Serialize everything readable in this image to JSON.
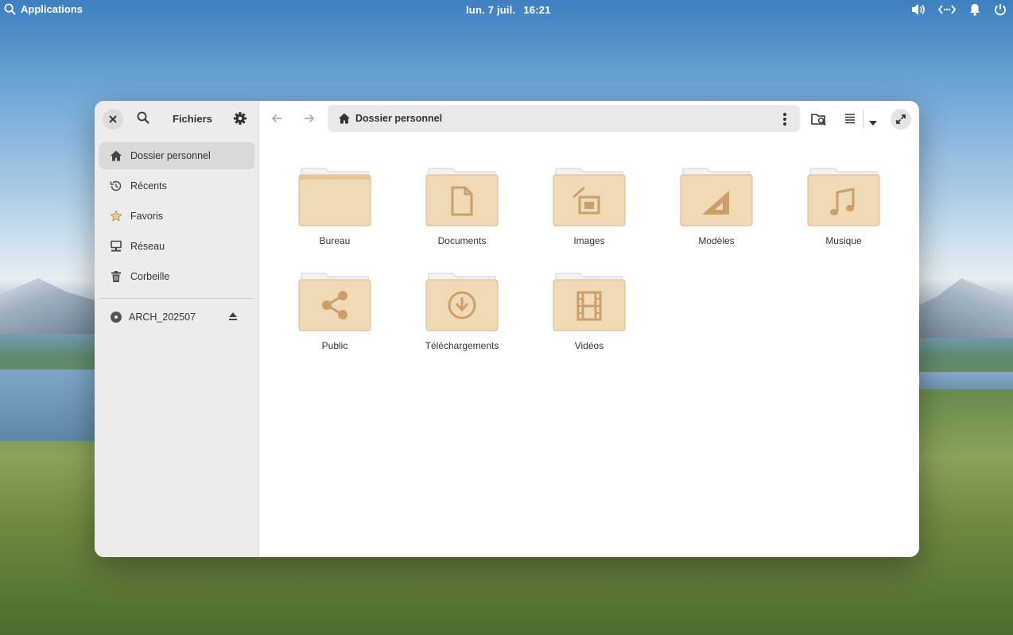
{
  "topbar": {
    "applications_label": "Applications",
    "date": "lun.  7 juil.",
    "time": "16:21"
  },
  "window": {
    "sidebar_title": "Fichiers",
    "sidebar_items": [
      {
        "label": "Dossier personnel",
        "icon": "home-icon",
        "active": true
      },
      {
        "label": "Récents",
        "icon": "history-icon"
      },
      {
        "label": "Favoris",
        "icon": "star-icon"
      },
      {
        "label": "Réseau",
        "icon": "network-icon"
      },
      {
        "label": "Corbeille",
        "icon": "trash-icon"
      }
    ],
    "drive": {
      "label": "ARCH_202507",
      "icon": "disc-icon"
    },
    "path": "Dossier personnel",
    "folders": [
      {
        "label": "Bureau",
        "icon": "folder-icon"
      },
      {
        "label": "Documents",
        "icon": "folder-documents-icon"
      },
      {
        "label": "Images",
        "icon": "folder-pictures-icon"
      },
      {
        "label": "Modèles",
        "icon": "folder-templates-icon"
      },
      {
        "label": "Musique",
        "icon": "folder-music-icon"
      },
      {
        "label": "Public",
        "icon": "folder-public-icon"
      },
      {
        "label": "Téléchargements",
        "icon": "folder-download-icon"
      },
      {
        "label": "Vidéos",
        "icon": "folder-videos-icon"
      }
    ]
  },
  "colors": {
    "folder": "#f0d9b5",
    "folder_dark": "#c9a06a",
    "sidebar": "#ececec",
    "accent": "#333333"
  }
}
